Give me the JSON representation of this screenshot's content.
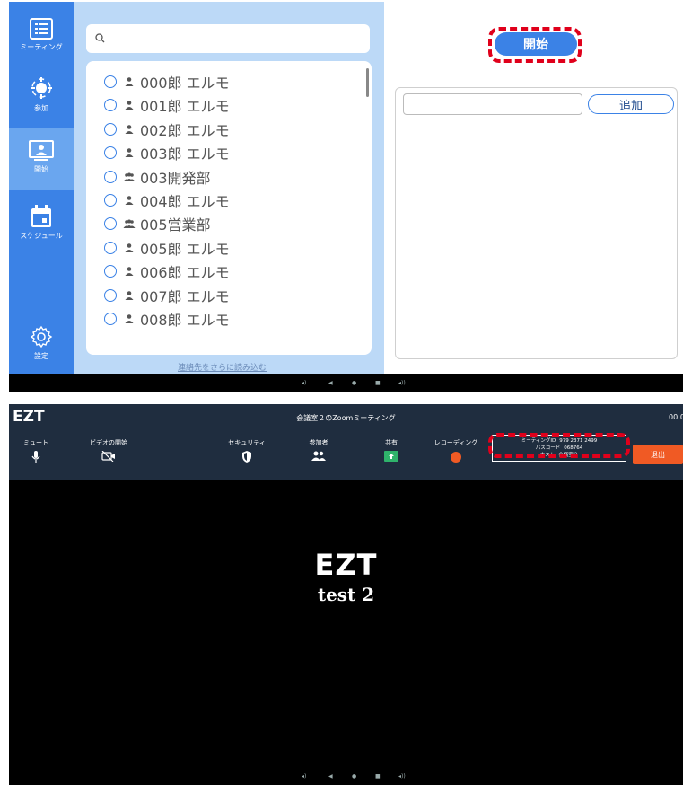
{
  "top": {
    "sidebar": {
      "meeting_label": "ミーティング",
      "join_label": "参加",
      "start_label": "開始",
      "schedule_label": "スケジュール",
      "settings_label": "設定"
    },
    "search": {
      "placeholder": ""
    },
    "contacts": [
      {
        "name": "000郎 エルモ",
        "type": "person"
      },
      {
        "name": "001郎 エルモ",
        "type": "person"
      },
      {
        "name": "002郎 エルモ",
        "type": "person"
      },
      {
        "name": "003郎 エルモ",
        "type": "person"
      },
      {
        "name": "003開発部",
        "type": "group"
      },
      {
        "name": "004郎 エルモ",
        "type": "person"
      },
      {
        "name": "005営業部",
        "type": "group"
      },
      {
        "name": "005郎 エルモ",
        "type": "person"
      },
      {
        "name": "006郎 エルモ",
        "type": "person"
      },
      {
        "name": "007郎 エルモ",
        "type": "person"
      },
      {
        "name": "008郎 エルモ",
        "type": "person"
      }
    ],
    "load_more": "連絡先をさらに読み込む",
    "start_button": "開始",
    "add_button": "追加",
    "colors": {
      "primary": "#3b82e6",
      "panel": "#bcd9f7",
      "highlight": "#e0001b"
    }
  },
  "bottom": {
    "logo": "EZT",
    "window_title": "会議室２のZoomミーティング",
    "clock": "00:0",
    "toolbar": {
      "mute": "ミュート",
      "video": "ビデオの開始",
      "security": "セキュリティ",
      "participants": "参加者",
      "share": "共有",
      "recording": "レコーディング"
    },
    "info": {
      "meeting_id_label": "ミーティングID",
      "meeting_id": "979 2371 2499",
      "passcode_label": "パスコード",
      "passcode": "068764",
      "host_label": "ホスト",
      "host": "会議室２"
    },
    "leave_button": "退出",
    "center_logo": "EZT",
    "center_name": "test 2"
  }
}
